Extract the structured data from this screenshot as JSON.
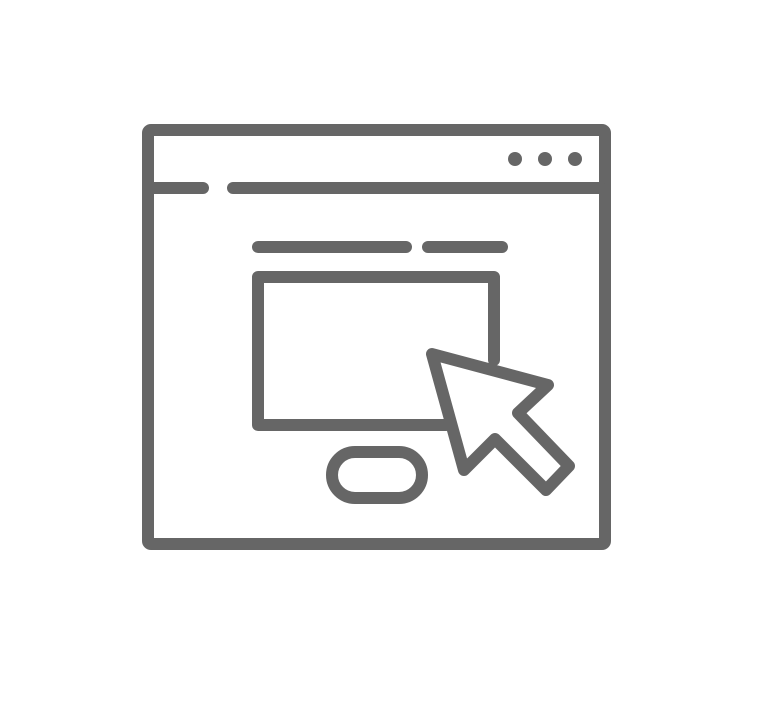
{
  "icon": {
    "name": "browser-window-click-icon",
    "stroke_color": "#666666",
    "background": "#ffffff",
    "parts": [
      "browser-window-frame",
      "title-bar-divider",
      "window-control-dots",
      "content-text-lines",
      "content-image-frame",
      "button-pill",
      "mouse-pointer-arrow"
    ]
  }
}
